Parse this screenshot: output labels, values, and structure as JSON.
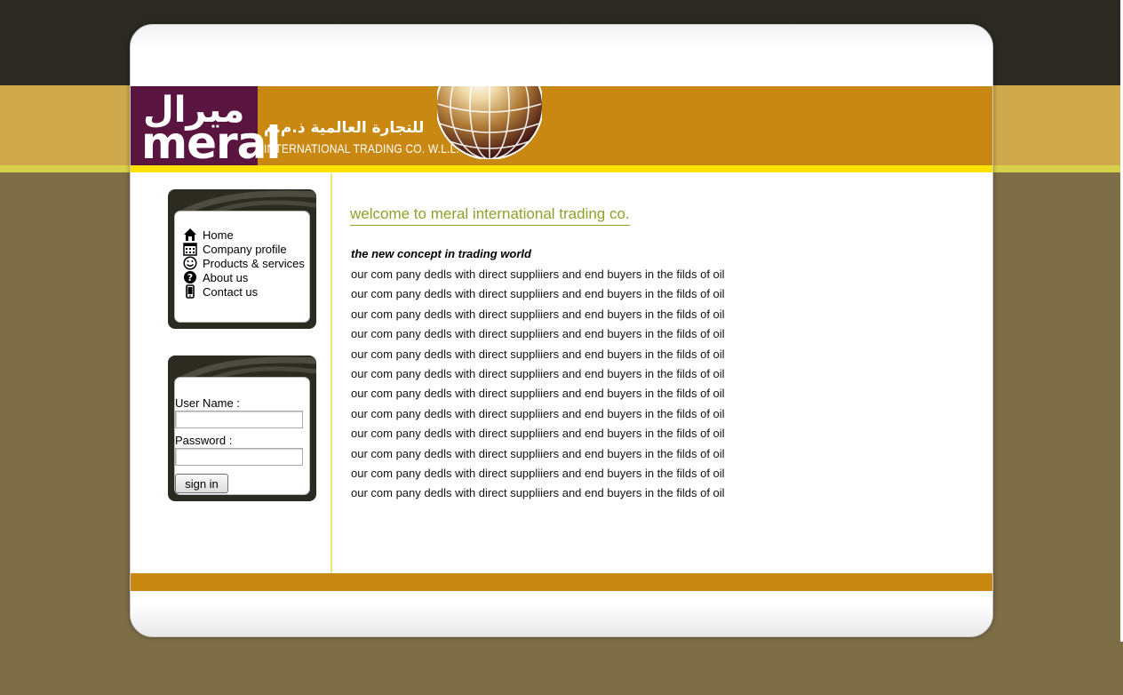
{
  "brand": {
    "logo_arabic": "ميرال",
    "logo_english": "meral",
    "company_arabic": "للتجارة العالمية ذ.م.م",
    "company_english": "INTERNATIONAL TRADING CO. W.L.L."
  },
  "nav": {
    "items": [
      {
        "label": "Home",
        "icon": "home-icon"
      },
      {
        "label": "Company profile",
        "icon": "calendar-icon"
      },
      {
        "label": "Products & services",
        "icon": "smiley-icon"
      },
      {
        "label": "About us",
        "icon": "question-icon"
      },
      {
        "label": "Contact us",
        "icon": "phone-icon"
      }
    ]
  },
  "login": {
    "username_label": "User Name :",
    "password_label": "Password :",
    "signin_label": "sign in"
  },
  "main": {
    "welcome": "welcome to meral international trading co.",
    "tagline": "the new concept in trading world",
    "lines": [
      "our com pany dedls with direct suppliiers and end buyers in the filds of oil",
      "our com pany dedls with direct suppliiers and end buyers in the filds of oil",
      "our com pany dedls with direct suppliiers and end buyers in the filds of oil",
      "our com pany dedls with direct suppliiers and end buyers in the filds of oil",
      "our com pany dedls with direct suppliiers and end buyers in the filds of oil",
      "our com pany dedls with direct suppliiers and end buyers in the filds of oil",
      "our com pany dedls with direct suppliiers and end buyers in the filds of oil",
      "our com pany dedls with direct suppliiers and end buyers in the filds of oil",
      "our com pany dedls with direct suppliiers and end buyers in the filds of oil",
      "our com pany dedls with direct suppliiers and end buyers in the filds of oil",
      "our com pany dedls with direct suppliiers and end buyers in the filds of oil",
      "our com pany dedls with direct suppliiers and end buyers in the filds of oil"
    ]
  },
  "colors": {
    "header_band": "#c98811",
    "logo_purple": "#5a1440",
    "accent_green": "#8ea12b",
    "accent_yellow": "#ffe200",
    "page_background": "#7e6e48"
  }
}
